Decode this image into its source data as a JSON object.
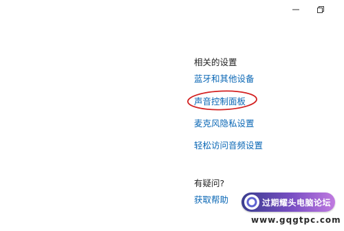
{
  "window_controls": {
    "minimize_icon": "minimize-icon",
    "restore_icon": "restore-icon"
  },
  "related_settings": {
    "heading": "相关的设置",
    "links": [
      "蓝牙和其他设备",
      "声音控制面板",
      "麦克风隐私设置",
      "轻松访问音频设置"
    ]
  },
  "questions": {
    "heading": "有疑问?",
    "help_link": "获取帮助"
  },
  "annotation": {
    "highlight_color": "#d32020"
  },
  "watermark": {
    "title": "过期耀头电脑论坛",
    "url": "www.gqgtpc.com"
  },
  "colors": {
    "link": "#0a67b5",
    "text": "#222222",
    "background": "#ffffff"
  }
}
